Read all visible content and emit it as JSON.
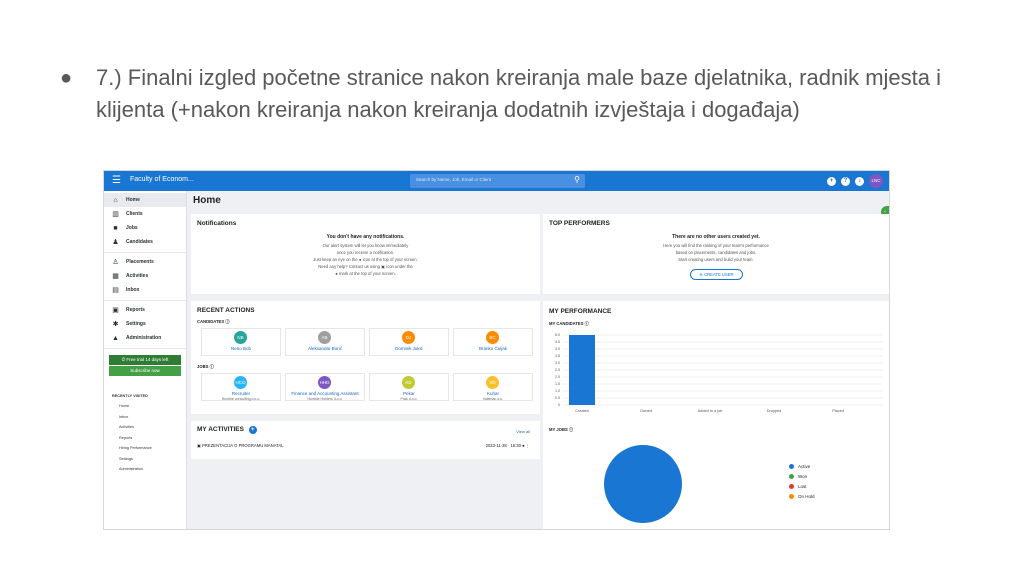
{
  "slide": {
    "bullet": "●",
    "text": "7.) Finalni izgled početne stranice nakon kreiranja male baze djelatnika, radnik mjesta i klijenta (+nakon kreiranja nakon kreiranja dodatnih izvještaja i događaja)"
  },
  "topbar": {
    "menu_glyph": "☰",
    "title": "Faculty of Econom...",
    "search_placeholder": "Search by Name, Job, Email or Client",
    "search_glyph": "⚲",
    "add_glyph": "+",
    "help_glyph": "?",
    "bell_glyph": "♪",
    "avatar_initials": "LNC"
  },
  "sidebar": {
    "groups": [
      [
        {
          "label": "Home",
          "icon": "home-icon",
          "glyph": "⌂",
          "active": true
        },
        {
          "label": "Clients",
          "icon": "building-icon",
          "glyph": "▥"
        },
        {
          "label": "Jobs",
          "icon": "briefcase-icon",
          "glyph": "■"
        },
        {
          "label": "Candidates",
          "icon": "people-icon",
          "glyph": "♟"
        }
      ],
      [
        {
          "label": "Placements",
          "icon": "person-check-icon",
          "glyph": "♙"
        },
        {
          "label": "Activities",
          "icon": "calendar-icon",
          "glyph": "▦"
        },
        {
          "label": "Inbox",
          "icon": "chat-icon",
          "glyph": "▤"
        }
      ],
      [
        {
          "label": "Reports",
          "icon": "report-icon",
          "glyph": "▣"
        },
        {
          "label": "Settings",
          "icon": "gear-icon",
          "glyph": "✱"
        },
        {
          "label": "Administration",
          "icon": "lock-icon",
          "glyph": "▲"
        }
      ]
    ],
    "trial": "⏱ Free trial 14 days left",
    "subscribe": "Subscribe now",
    "recent_heading": "RECENTLY VISITED",
    "recent_items": [
      "Home",
      "Inbox",
      "Activities",
      "Reports",
      "Hiring Performance",
      "Settings",
      "Administration"
    ]
  },
  "main": {
    "title": "Home",
    "notifications": {
      "title": "Notifications",
      "headline": "You don't have any notifications.",
      "lines": [
        "Our alert system will let you know immediately",
        "once you receive a notification.",
        "Just keep an eye on the ● icon at the top of your screen.",
        "Need any help? Contact us using ▣ icon under the",
        "● mark at the top of your screen."
      ]
    },
    "top_performers": {
      "title": "TOP PERFORMERS",
      "headline": "There are no other users created yet.",
      "lines": [
        "Here you will find the ranking of your team's performance",
        "based on placements, candidates and jobs.",
        "Start creating users and build your team."
      ],
      "button": "⊕ CREATE USER"
    },
    "recent_actions": {
      "title": "RECENT ACTIONS",
      "candidates_label": "CANDIDATES ⓘ",
      "jobs_label": "JOBS ⓘ",
      "candidates": [
        {
          "initials": "NB",
          "name": "Neno Bob",
          "color": "#26a69a"
        },
        {
          "initials": "AB",
          "name": "Aleksandar Borić",
          "color": "#9e9e9e"
        },
        {
          "initials": "DJ",
          "name": "Dominik Jukić",
          "color": "#fb8c00"
        },
        {
          "initials": "BC",
          "name": "Branko Čuljak",
          "color": "#fb8c00"
        }
      ],
      "jobs": [
        {
          "initials": "HCO",
          "name": "Recruiter",
          "company": "Humble consulting d.o.o.",
          "color": "#29b6f6"
        },
        {
          "initials": "HHD",
          "name": "Finance and Accounting Assistant",
          "company": "Humble Hunters d.o.o.",
          "color": "#7e57c2"
        },
        {
          "initials": "KD",
          "name": "Pekar",
          "company": "Prak d.o.o.",
          "color": "#c0ca33"
        },
        {
          "initials": "VD",
          "name": "Kuhar",
          "company": "Valeman d.o.",
          "color": "#fbc02d"
        }
      ]
    },
    "my_activities": {
      "title": "MY ACTIVITIES",
      "view_all": "View all",
      "item": "▣ PREZENTACIJA O PROGRAMU MANATAL",
      "date": "2023-11-28 · 16:30 ● ⋮"
    },
    "my_performance": {
      "title": "MY PERFORMANCE",
      "candidates_label": "MY CANDIDATES ⓘ",
      "jobs_label": "MY JOBS ⓘ"
    }
  },
  "chart_data": [
    {
      "type": "bar",
      "title": "MY CANDIDATES",
      "categories": [
        "Created",
        "Owned",
        "Added to a job",
        "Dropped",
        "Placed"
      ],
      "values": [
        5,
        0,
        0,
        0,
        0
      ],
      "yticks": [
        "0",
        "0.5",
        "1.0",
        "1.5",
        "2.0",
        "2.5",
        "3.0",
        "3.5",
        "4.0",
        "4.5",
        "5.0"
      ],
      "ylim": [
        0,
        5
      ],
      "grid": true,
      "color": "#1976d2"
    },
    {
      "type": "pie",
      "title": "MY JOBS",
      "labels": [
        "Active",
        "Won",
        "Lost",
        "On Hold"
      ],
      "values": [
        4,
        0,
        0,
        0
      ],
      "colors": [
        "#1976d2",
        "#43a047",
        "#e53935",
        "#fb8c00"
      ],
      "legend": "right"
    }
  ]
}
